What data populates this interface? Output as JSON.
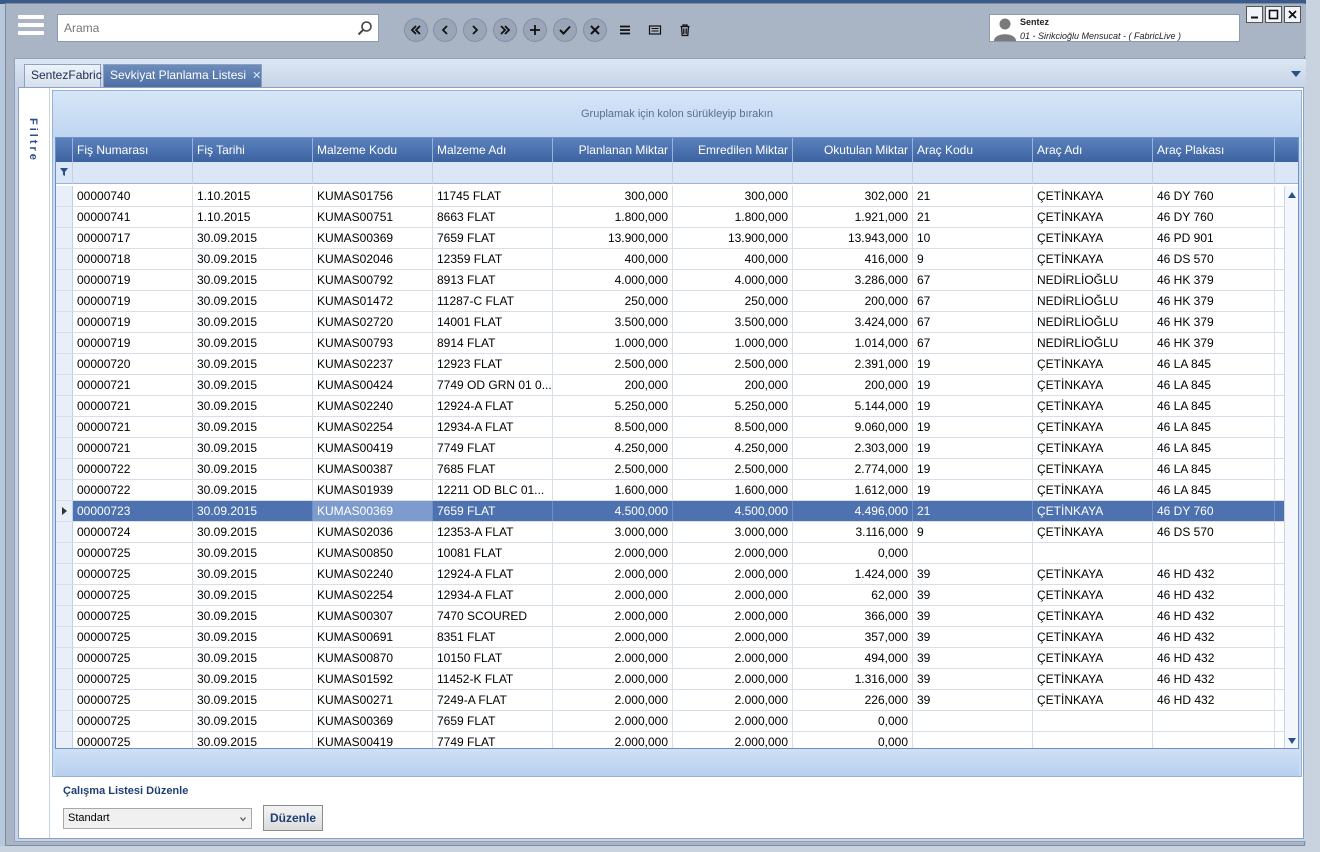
{
  "toolbar": {
    "search_placeholder": "Arama",
    "nav_buttons": [
      "first",
      "previous",
      "next",
      "last",
      "add",
      "save",
      "cancel",
      "list",
      "preview",
      "delete"
    ]
  },
  "user": {
    "name": "Sentez",
    "company": "01 - Sirikcioğlu Mensucat - ( FabricLive )"
  },
  "tabs": [
    {
      "label": "SentezFabric"
    },
    {
      "label": "Sevkiyat Planlama Listesi"
    }
  ],
  "filter_panel": {
    "label": "Filtre"
  },
  "grid": {
    "group_hint": "Gruplamak için kolon sürükleyip bırakın",
    "columns": [
      {
        "key": "fis_no",
        "label": "Fiş Numarası"
      },
      {
        "key": "fis_tarihi",
        "label": "Fiş Tarihi"
      },
      {
        "key": "malzeme_kodu",
        "label": "Malzeme Kodu"
      },
      {
        "key": "malzeme_adi",
        "label": "Malzeme Adı"
      },
      {
        "key": "planlanan",
        "label": "Planlanan Miktar"
      },
      {
        "key": "emredilen",
        "label": "Emredilen Miktar"
      },
      {
        "key": "okutulan",
        "label": "Okutulan Miktar"
      },
      {
        "key": "arac_kodu",
        "label": "Araç Kodu"
      },
      {
        "key": "arac_adi",
        "label": "Araç Adı"
      },
      {
        "key": "arac_plakasi",
        "label": "Araç Plakası"
      }
    ],
    "selected_row": 15,
    "rows": [
      [
        "00000740",
        "1.10.2015",
        "KUMAS01756",
        "11745 FLAT",
        "300,000",
        "300,000",
        "302,000",
        "21",
        "ÇETİNKAYA",
        "46 DY 760"
      ],
      [
        "00000741",
        "1.10.2015",
        "KUMAS00751",
        "8663 FLAT",
        "1.800,000",
        "1.800,000",
        "1.921,000",
        "21",
        "ÇETİNKAYA",
        "46 DY 760"
      ],
      [
        "00000717",
        "30.09.2015",
        "KUMAS00369",
        "7659 FLAT",
        "13.900,000",
        "13.900,000",
        "13.943,000",
        "10",
        "ÇETİNKAYA",
        "46 PD 901"
      ],
      [
        "00000718",
        "30.09.2015",
        "KUMAS02046",
        "12359 FLAT",
        "400,000",
        "400,000",
        "416,000",
        "9",
        "ÇETİNKAYA",
        "46 DS 570"
      ],
      [
        "00000719",
        "30.09.2015",
        "KUMAS00792",
        "8913 FLAT",
        "4.000,000",
        "4.000,000",
        "3.286,000",
        "67",
        "NEDİRLİOĞLU",
        "46 HK 379"
      ],
      [
        "00000719",
        "30.09.2015",
        "KUMAS01472",
        "11287-C FLAT",
        "250,000",
        "250,000",
        "200,000",
        "67",
        "NEDİRLİOĞLU",
        "46 HK 379"
      ],
      [
        "00000719",
        "30.09.2015",
        "KUMAS02720",
        "14001 FLAT",
        "3.500,000",
        "3.500,000",
        "3.424,000",
        "67",
        "NEDİRLİOĞLU",
        "46 HK 379"
      ],
      [
        "00000719",
        "30.09.2015",
        "KUMAS00793",
        "8914 FLAT",
        "1.000,000",
        "1.000,000",
        "1.014,000",
        "67",
        "NEDİRLİOĞLU",
        "46 HK 379"
      ],
      [
        "00000720",
        "30.09.2015",
        "KUMAS02237",
        "12923 FLAT",
        "2.500,000",
        "2.500,000",
        "2.391,000",
        "19",
        "ÇETİNKAYA",
        "46 LA 845"
      ],
      [
        "00000721",
        "30.09.2015",
        "KUMAS00424",
        "7749 OD GRN 01 0...",
        "200,000",
        "200,000",
        "200,000",
        "19",
        "ÇETİNKAYA",
        "46 LA 845"
      ],
      [
        "00000721",
        "30.09.2015",
        "KUMAS02240",
        "12924-A FLAT",
        "5.250,000",
        "5.250,000",
        "5.144,000",
        "19",
        "ÇETİNKAYA",
        "46 LA 845"
      ],
      [
        "00000721",
        "30.09.2015",
        "KUMAS02254",
        "12934-A FLAT",
        "8.500,000",
        "8.500,000",
        "9.060,000",
        "19",
        "ÇETİNKAYA",
        "46 LA 845"
      ],
      [
        "00000721",
        "30.09.2015",
        "KUMAS00419",
        "7749 FLAT",
        "4.250,000",
        "4.250,000",
        "2.303,000",
        "19",
        "ÇETİNKAYA",
        "46 LA 845"
      ],
      [
        "00000722",
        "30.09.2015",
        "KUMAS00387",
        "7685 FLAT",
        "2.500,000",
        "2.500,000",
        "2.774,000",
        "19",
        "ÇETİNKAYA",
        "46 LA 845"
      ],
      [
        "00000722",
        "30.09.2015",
        "KUMAS01939",
        "12211 OD BLC 01...",
        "1.600,000",
        "1.600,000",
        "1.612,000",
        "19",
        "ÇETİNKAYA",
        "46 LA 845"
      ],
      [
        "00000723",
        "30.09.2015",
        "KUMAS00369",
        "7659 FLAT",
        "4.500,000",
        "4.500,000",
        "4.496,000",
        "21",
        "ÇETİNKAYA",
        "46 DY 760"
      ],
      [
        "00000724",
        "30.09.2015",
        "KUMAS02036",
        "12353-A FLAT",
        "3.000,000",
        "3.000,000",
        "3.116,000",
        "9",
        "ÇETİNKAYA",
        "46 DS 570"
      ],
      [
        "00000725",
        "30.09.2015",
        "KUMAS00850",
        "10081 FLAT",
        "2.000,000",
        "2.000,000",
        "0,000",
        "",
        "",
        ""
      ],
      [
        "00000725",
        "30.09.2015",
        "KUMAS02240",
        "12924-A FLAT",
        "2.000,000",
        "2.000,000",
        "1.424,000",
        "39",
        "ÇETİNKAYA",
        "46 HD 432"
      ],
      [
        "00000725",
        "30.09.2015",
        "KUMAS02254",
        "12934-A FLAT",
        "2.000,000",
        "2.000,000",
        "62,000",
        "39",
        "ÇETİNKAYA",
        "46 HD 432"
      ],
      [
        "00000725",
        "30.09.2015",
        "KUMAS00307",
        "7470 SCOURED",
        "2.000,000",
        "2.000,000",
        "366,000",
        "39",
        "ÇETİNKAYA",
        "46 HD 432"
      ],
      [
        "00000725",
        "30.09.2015",
        "KUMAS00691",
        "8351 FLAT",
        "2.000,000",
        "2.000,000",
        "357,000",
        "39",
        "ÇETİNKAYA",
        "46 HD 432"
      ],
      [
        "00000725",
        "30.09.2015",
        "KUMAS00870",
        "10150 FLAT",
        "2.000,000",
        "2.000,000",
        "494,000",
        "39",
        "ÇETİNKAYA",
        "46 HD 432"
      ],
      [
        "00000725",
        "30.09.2015",
        "KUMAS01592",
        "11452-K FLAT",
        "2.000,000",
        "2.000,000",
        "1.316,000",
        "39",
        "ÇETİNKAYA",
        "46 HD 432"
      ],
      [
        "00000725",
        "30.09.2015",
        "KUMAS00271",
        "7249-A FLAT",
        "2.000,000",
        "2.000,000",
        "226,000",
        "39",
        "ÇETİNKAYA",
        "46 HD 432"
      ],
      [
        "00000725",
        "30.09.2015",
        "KUMAS00369",
        "7659 FLAT",
        "2.000,000",
        "2.000,000",
        "0,000",
        "",
        "",
        ""
      ],
      [
        "00000725",
        "30.09.2015",
        "KUMAS00419",
        "7749 FLAT",
        "2.000,000",
        "2.000,000",
        "0,000",
        "",
        "",
        ""
      ]
    ]
  },
  "worklist": {
    "label": "Çalışma Listesi Düzenle",
    "layout_value": "Standart",
    "edit_button": "Düzenle"
  },
  "colors": {
    "header_blue": "#3c63a0",
    "selected_row": "#4e72b0",
    "chrome_gray": "#a9b4c5"
  }
}
